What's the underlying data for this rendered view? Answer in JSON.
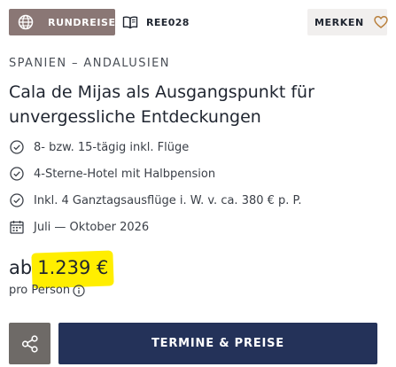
{
  "header": {
    "badge_label": "RUNDREISE",
    "badge_icon": "globe-icon",
    "code_label": "REE028",
    "code_icon": "book-icon",
    "merken_label": "MERKEN",
    "merken_icon": "heart-icon"
  },
  "offer": {
    "region": "SPANIEN – ANDALUSIEN",
    "title": "Cala de Mijas als Ausgangspunkt für unvergessliche Entdeckungen",
    "features": [
      {
        "icon": "check-circle-icon",
        "text": "8- bzw. 15-tägig inkl. Flüge"
      },
      {
        "icon": "check-circle-icon",
        "text": "4-Sterne-Hotel mit Halbpension"
      },
      {
        "icon": "check-circle-icon",
        "text": "Inkl. 4 Ganztagsausflüge i. W. v. ca. 380 € p. P."
      },
      {
        "icon": "calendar-icon",
        "text": "Juli — Oktober 2026"
      }
    ],
    "price_prefix": "ab",
    "price_value": "1.239 €",
    "price_note": "pro Person"
  },
  "actions": {
    "share_icon": "share-icon",
    "cta_label": "TERMINE & PREISE"
  },
  "colors": {
    "badge_bg": "#8a7775",
    "cta_bg": "#243259",
    "share_bg": "#6e6a67",
    "highlight": "#ffee00",
    "merken_bg": "#f1efee"
  }
}
